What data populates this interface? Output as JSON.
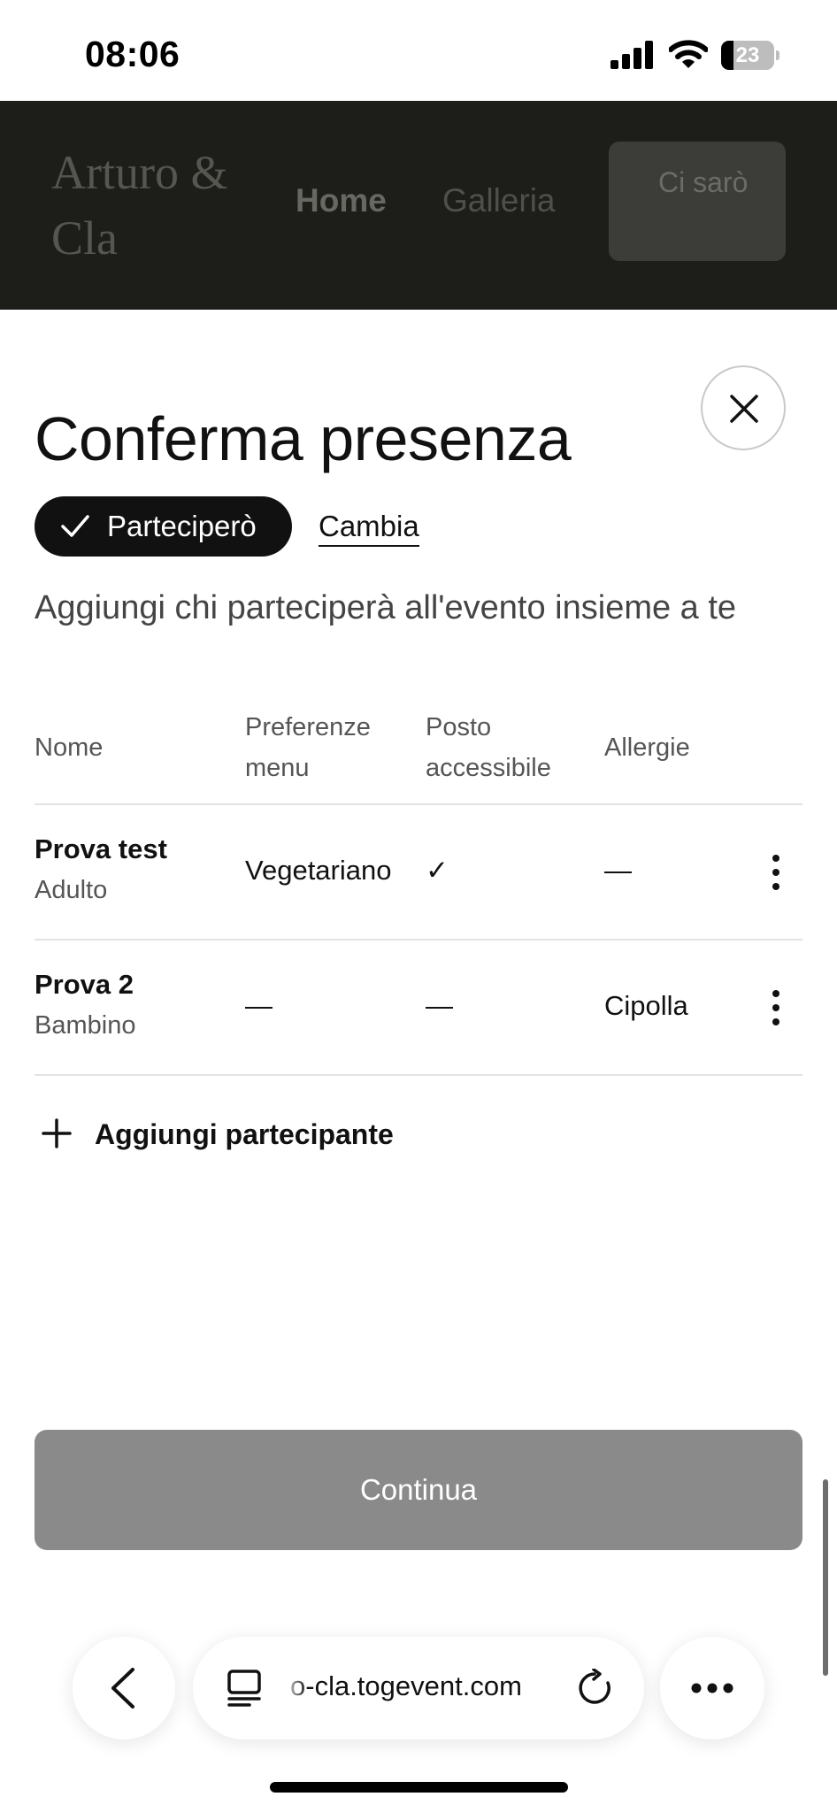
{
  "status_bar": {
    "time": "08:06",
    "battery_level": "23",
    "icons": [
      "signal-icon",
      "wifi-icon",
      "battery-icon"
    ]
  },
  "site_header": {
    "logo": "Arturo & Cla",
    "nav_home": "Home",
    "nav_gallery": "Galleria",
    "rsvp_button": "Ci sarò"
  },
  "sheet": {
    "title": "Conferma presenza",
    "status_pill": "Parteciperò",
    "change_link": "Cambia",
    "subtitle": "Aggiungi chi parteciperà all'evento insieme a te",
    "table": {
      "headers": {
        "name": "Nome",
        "menu": "Preferenze menu",
        "access": "Posto accessibile",
        "allergy": "Allergie"
      },
      "rows": [
        {
          "name": "Prova test",
          "type": "Adulto",
          "menu": "Vegetariano",
          "access": "✓",
          "allergy": "—"
        },
        {
          "name": "Prova 2",
          "type": "Bambino",
          "menu": "—",
          "access": "—",
          "allergy": "Cipolla"
        }
      ]
    },
    "add_participant": "Aggiungi partecipante",
    "continue_button": "Continua"
  },
  "browser": {
    "url": "o-cla.togevent.com",
    "icons": [
      "back-icon",
      "tabs-icon",
      "reload-icon",
      "more-icon"
    ]
  },
  "colors": {
    "primary_dark": "#111111",
    "continue_disabled": "#8a8a8a",
    "overlay_header": "#1d1e1a"
  }
}
